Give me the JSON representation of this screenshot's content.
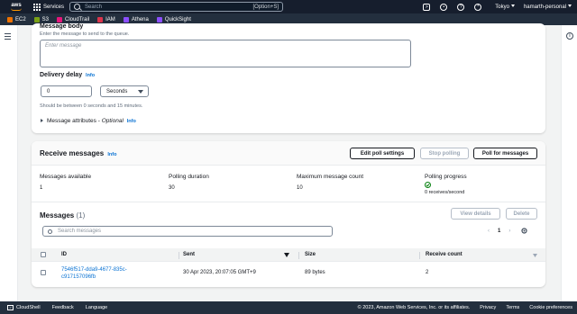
{
  "topnav": {
    "logo": "aws",
    "services": "Services",
    "search_placeholder": "Search",
    "search_shortcut": "[Option+S]",
    "region": "Tokyo",
    "account": "hamarth-personal"
  },
  "favorites": [
    {
      "label": "EC2",
      "color": "#ed7100"
    },
    {
      "label": "S3",
      "color": "#7aa116"
    },
    {
      "label": "CloudTrail",
      "color": "#e7157b"
    },
    {
      "label": "IAM",
      "color": "#dd344c"
    },
    {
      "label": "Athena",
      "color": "#8c4fff"
    },
    {
      "label": "QuickSight",
      "color": "#8c4fff"
    }
  ],
  "send": {
    "body_label": "Message body",
    "body_hint": "Enter the message to send to the queue.",
    "body_placeholder": "Enter message",
    "delay_label": "Delivery delay",
    "info": "Info",
    "delay_value": "0",
    "delay_unit": "Seconds",
    "delay_hint": "Should be between 0 seconds and 15 minutes.",
    "attributes_label": "Message attributes",
    "attributes_optional": "Optional"
  },
  "receive": {
    "title": "Receive messages",
    "info": "Info",
    "edit_poll": "Edit poll settings",
    "stop_polling": "Stop polling",
    "poll_messages": "Poll for messages",
    "stats": [
      {
        "label": "Messages available",
        "value": "1"
      },
      {
        "label": "Polling duration",
        "value": "30"
      },
      {
        "label": "Maximum message count",
        "value": "10"
      },
      {
        "label": "Polling progress",
        "value": "0 receives/second"
      }
    ]
  },
  "messages": {
    "title": "Messages",
    "count": "(1)",
    "view_details": "View details",
    "delete": "Delete",
    "search_placeholder": "Search messages",
    "page": "1",
    "columns": [
      "ID",
      "Sent",
      "Size",
      "Receive count"
    ],
    "rows": [
      {
        "id_line1": "7546f517-dda9-4677-835c-",
        "id_line2": "c917157096fb",
        "sent": "30 Apr 2023, 20:07:05 GMT+9",
        "size": "89 bytes",
        "receive_count": "2"
      }
    ]
  },
  "footer": {
    "cloudshell": "CloudShell",
    "feedback": "Feedback",
    "language": "Language",
    "copyright": "© 2023, Amazon Web Services, Inc. or its affiliates.",
    "privacy": "Privacy",
    "terms": "Terms",
    "cookies": "Cookie preferences"
  },
  "colors": {
    "nav_bg": "#161e2d",
    "link": "#0972d3",
    "success": "#037f0c"
  }
}
